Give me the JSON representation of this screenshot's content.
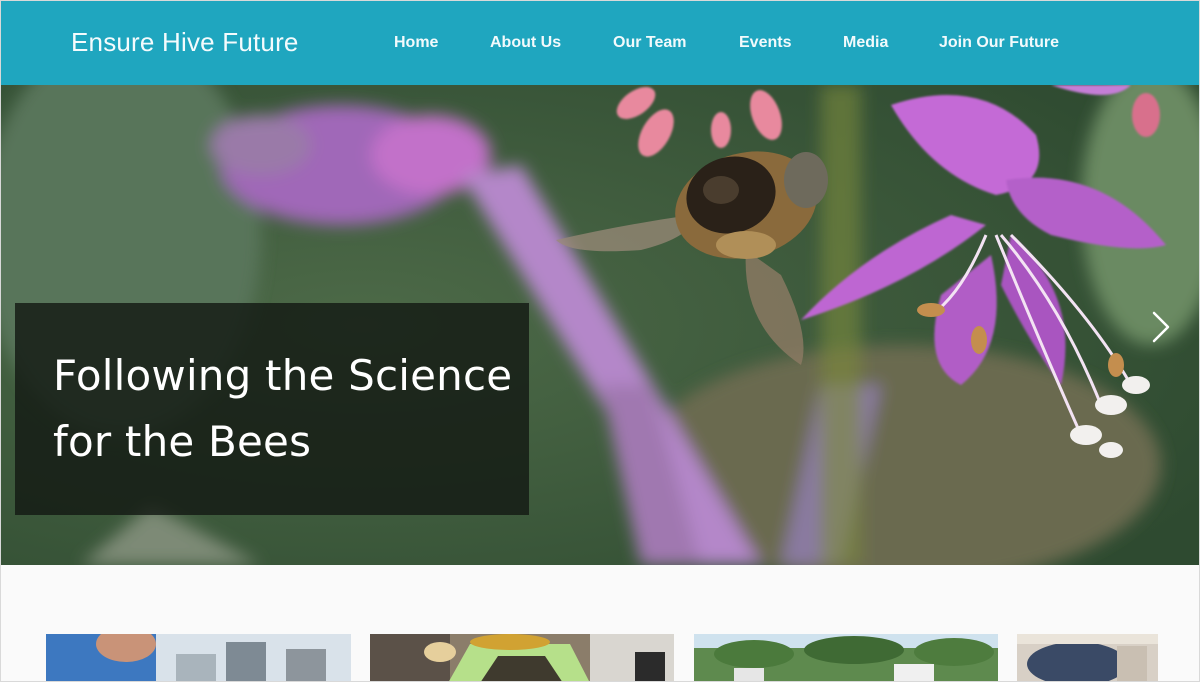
{
  "header": {
    "brand": "Ensure Hive Future",
    "nav": [
      {
        "label": "Home"
      },
      {
        "label": "About Us"
      },
      {
        "label": "Our Team"
      },
      {
        "label": "Events"
      },
      {
        "label": "Media"
      },
      {
        "label": "Join Our Future"
      }
    ]
  },
  "hero": {
    "caption_line1": "Following the Science",
    "caption_line2": "for the Bees",
    "next_icon": "chevron-right-icon"
  },
  "thumbnails": [
    {
      "name": "thumbnail-1"
    },
    {
      "name": "thumbnail-2"
    },
    {
      "name": "thumbnail-3"
    },
    {
      "name": "thumbnail-4"
    }
  ],
  "colors": {
    "header_bg": "#1fa6bf",
    "caption_bg": "#141a14"
  }
}
